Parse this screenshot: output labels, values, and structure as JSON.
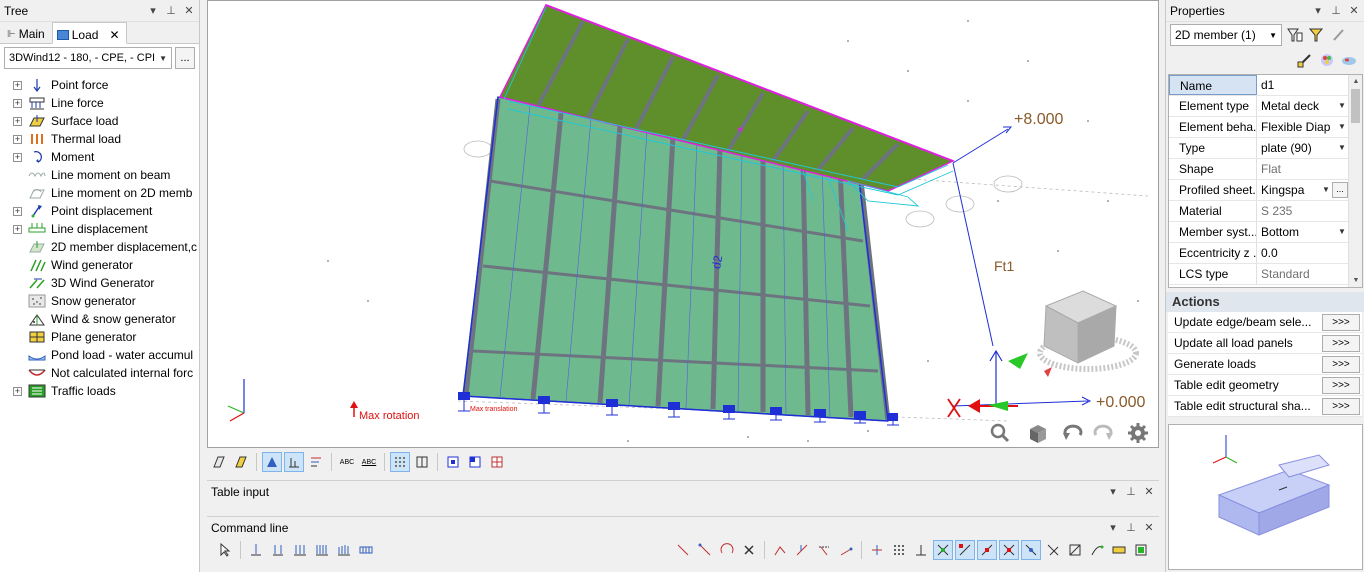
{
  "tree_panel": {
    "title": "Tree",
    "tabs": [
      {
        "label": "Main",
        "active": false
      },
      {
        "label": "Load",
        "active": true
      }
    ],
    "load_case_combo": "3DWind12 - 180, - CPE, - CPI",
    "more_label": "...",
    "items": [
      {
        "label": "Point force",
        "icon": "point-force-icon",
        "expandable": true
      },
      {
        "label": "Line force",
        "icon": "line-force-icon",
        "expandable": true
      },
      {
        "label": "Surface load",
        "icon": "surface-load-icon",
        "expandable": true
      },
      {
        "label": "Thermal load",
        "icon": "thermal-load-icon",
        "expandable": true
      },
      {
        "label": "Moment",
        "icon": "moment-icon",
        "expandable": true
      },
      {
        "label": "Line moment on beam",
        "icon": "line-moment-beam-icon",
        "expandable": false
      },
      {
        "label": "Line moment on 2D memb",
        "icon": "line-moment-2d-icon",
        "expandable": false
      },
      {
        "label": "Point displacement",
        "icon": "point-displacement-icon",
        "expandable": true
      },
      {
        "label": "Line displacement",
        "icon": "line-displacement-icon",
        "expandable": true
      },
      {
        "label": "2D member displacement,c",
        "icon": "2d-displacement-icon",
        "expandable": false
      },
      {
        "label": "Wind generator",
        "icon": "wind-generator-icon",
        "expandable": false
      },
      {
        "label": "3D Wind Generator",
        "icon": "3d-wind-generator-icon",
        "expandable": false
      },
      {
        "label": "Snow generator",
        "icon": "snow-generator-icon",
        "expandable": false
      },
      {
        "label": "Wind & snow generator",
        "icon": "wind-snow-generator-icon",
        "expandable": false
      },
      {
        "label": "Plane generator",
        "icon": "plane-generator-icon",
        "expandable": false
      },
      {
        "label": "Pond load - water accumul",
        "icon": "pond-load-icon",
        "expandable": false
      },
      {
        "label": "Not calculated internal forc",
        "icon": "internal-force-icon",
        "expandable": false
      },
      {
        "label": "Traffic loads",
        "icon": "traffic-loads-icon",
        "expandable": true
      }
    ]
  },
  "viewport": {
    "labels": {
      "dim_top": "+8.000",
      "dim_bottom": "+0.000",
      "member_label": "d2",
      "load_label": "Ft1",
      "max_rotation": "Max rotation",
      "max_translation": "Max translation"
    },
    "nav_icons": [
      "zoom-icon",
      "view-cube-icon",
      "rotate-icon",
      "pan-icon",
      "settings-icon"
    ]
  },
  "table_input": {
    "title": "Table input"
  },
  "command_line": {
    "title": "Command line"
  },
  "properties": {
    "title": "Properties",
    "selection_combo": "2D member (1)",
    "rows": [
      {
        "key": "Name",
        "value": "d1",
        "control": "text",
        "selected": true
      },
      {
        "key": "Element type",
        "value": "Metal deck",
        "control": "dropdown"
      },
      {
        "key": "Element beha...",
        "value": "Flexible Diap",
        "control": "dropdown"
      },
      {
        "key": "Type",
        "value": "plate (90)",
        "control": "dropdown"
      },
      {
        "key": "Shape",
        "value": "Flat",
        "control": "readonly"
      },
      {
        "key": "Profiled sheet...",
        "value": "Kingspa",
        "control": "dropdown-more"
      },
      {
        "key": "Material",
        "value": "S 235",
        "control": "readonly"
      },
      {
        "key": "Member syst...",
        "value": "Bottom",
        "control": "dropdown"
      },
      {
        "key": "Eccentricity z ...",
        "value": "0.0",
        "control": "text"
      },
      {
        "key": "LCS type",
        "value": "Standard",
        "control": "readonly"
      }
    ],
    "actions_title": "Actions",
    "actions": [
      {
        "label": "Update edge/beam sele...",
        "button": ">>>"
      },
      {
        "label": "Update all load panels",
        "button": ">>>"
      },
      {
        "label": "Generate loads",
        "button": ">>>"
      },
      {
        "label": "Table edit geometry",
        "button": ">>>"
      },
      {
        "label": "Table edit structural sha...",
        "button": ">>>"
      }
    ]
  },
  "colors": {
    "panel_fill": "#6fb98f",
    "roof_fill": "#5f8f2a",
    "member_grey": "#6d7480",
    "edge_blue": "#1f2fd6",
    "cyan": "#20c8d8",
    "magenta": "#e020e0",
    "dim_text": "#8a5a2a",
    "red": "#e01010"
  }
}
